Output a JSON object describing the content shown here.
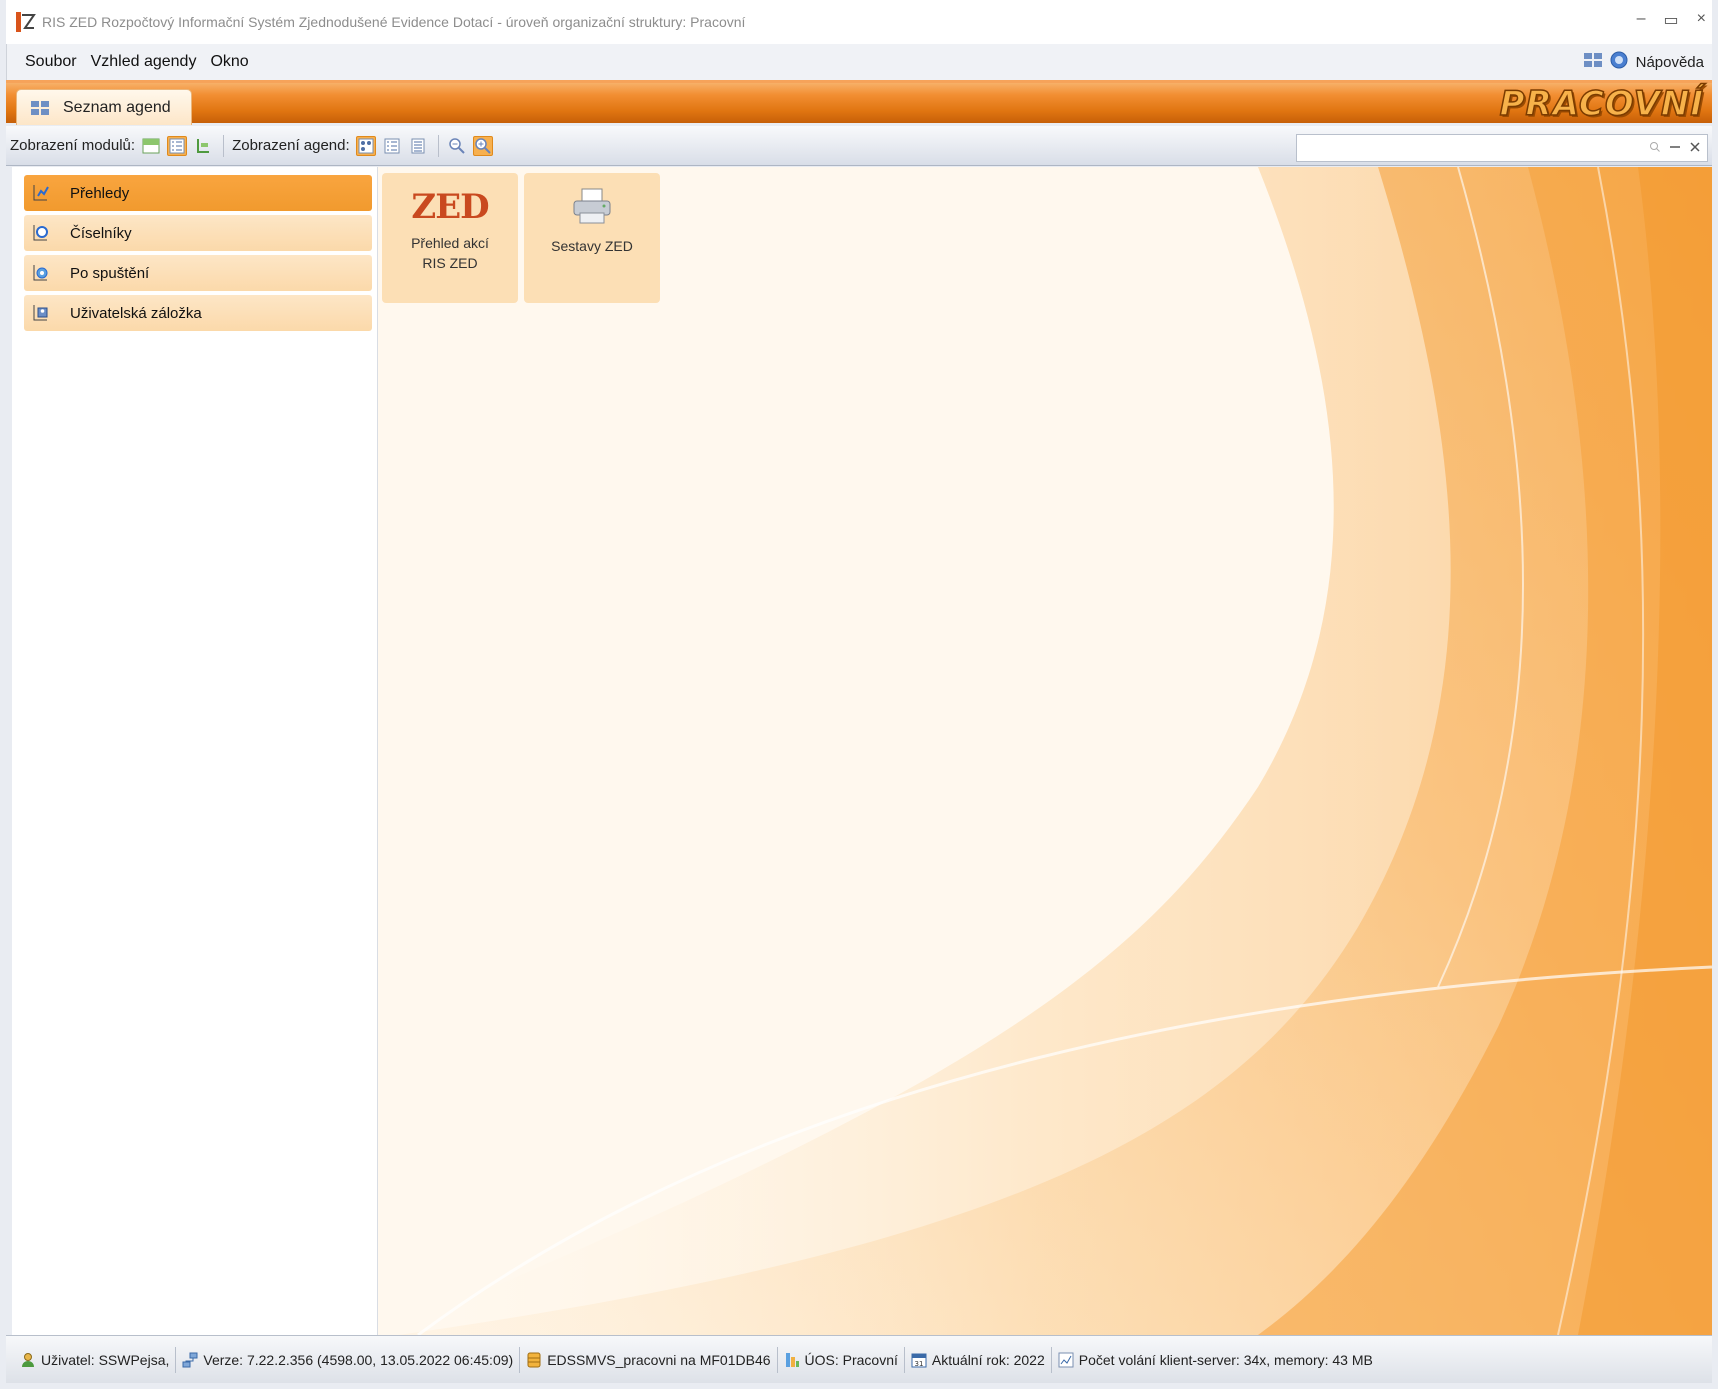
{
  "window": {
    "title": "RIS ZED Rozpočtový Informační Systém Zjednodušené Evidence Dotací - úroveň organizační struktury: Pracovní",
    "controls": {
      "minimize": "–",
      "maximize": "▭",
      "close": "×"
    }
  },
  "menubar": {
    "items": [
      "Soubor",
      "Vzhled agendy",
      "Okno"
    ],
    "help_label": "Nápověda"
  },
  "tabs": [
    {
      "label": "Seznam agend"
    }
  ],
  "brand": "PRACOVNÍ",
  "toolbar": {
    "module_view_label": "Zobrazení modulů:",
    "agenda_view_label": "Zobrazení agend:",
    "search": {
      "value": "",
      "placeholder": ""
    }
  },
  "sidebar": {
    "items": [
      {
        "label": "Přehledy",
        "icon": "overview-icon",
        "active": true
      },
      {
        "label": "Číselníky",
        "icon": "codebook-icon",
        "active": false
      },
      {
        "label": "Po spuštění",
        "icon": "startup-icon",
        "active": false
      },
      {
        "label": "Uživatelská záložka",
        "icon": "user-tab-icon",
        "active": false
      }
    ]
  },
  "tiles": [
    {
      "label_line1": "Přehled akcí",
      "label_line2": "RIS ZED",
      "icon": "zed-logo-icon",
      "logo_text": "ZED"
    },
    {
      "label_line1": "Sestavy ZED",
      "label_line2": "",
      "icon": "printer-icon"
    }
  ],
  "statusbar": {
    "user": "Uživatel: SSWPejsa,",
    "version": "Verze: 7.22.2.356 (4598.00, 13.05.2022 06:45:09)",
    "database": "EDSSMVS_pracovni na MF01DB46",
    "uos": "ÚOS: Pracovní",
    "year": "Aktuální rok: 2022",
    "calls": "Počet volání klient-server: 34x, memory: 43 MB",
    "calendar_day": "31"
  },
  "colors": {
    "accent": "#f19a2e",
    "tab_orange": "#e07511",
    "tile_bg": "#fbdaaa"
  }
}
